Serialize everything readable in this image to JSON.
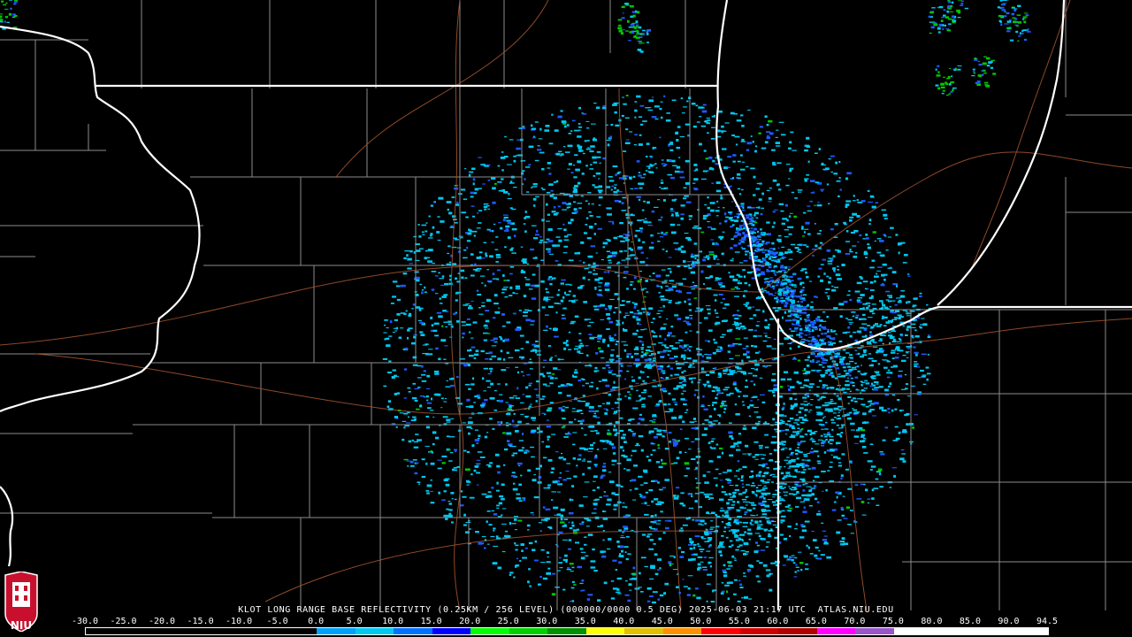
{
  "map": {
    "title": "KLOT LONG RANGE BASE REFLECTIVITY (0.25KM / 256 LEVEL) (000000/0000 0.5 DEG) 2025-06-03 21:17 UTC  ATLAS.NIU.EDU",
    "radar_site": "KLOT",
    "product": "LONG RANGE BASE REFLECTIVITY",
    "elevation": "0.5 DEG",
    "timestamp": "2025-06-03 21:17 UTC",
    "source": "ATLAS.NIU.EDU",
    "colors": {
      "background": "#000000",
      "state_border": "#ffffff",
      "county_border": "#8c8c8c",
      "road": "#a0522d",
      "echo_light": "#00c8f0",
      "echo_mid": "#1e5aff",
      "echo_strong": "#00c800"
    }
  },
  "legend": {
    "labels": [
      "-30.0",
      "-25.0",
      "-20.0",
      "-15.0",
      "-10.0",
      "-5.0",
      "0.0",
      "5.0",
      "10.0",
      "15.0",
      "20.0",
      "25.0",
      "30.0",
      "35.0",
      "40.0",
      "45.0",
      "50.0",
      "55.0",
      "60.0",
      "65.0",
      "70.0",
      "75.0",
      "80.0",
      "85.0",
      "90.0",
      "94.5"
    ],
    "colors": [
      "#000000",
      "#000000",
      "#000000",
      "#000000",
      "#000000",
      "#000000",
      "#00a0ff",
      "#00c8f0",
      "#0070ff",
      "#0000ff",
      "#00ff00",
      "#00d000",
      "#009000",
      "#ffff00",
      "#e0c000",
      "#ff9000",
      "#ff0000",
      "#d00000",
      "#b00000",
      "#ff00ff",
      "#9955c9",
      "#ffffff",
      "#ffffff",
      "#ffffff",
      "#ffffff"
    ]
  },
  "logo": {
    "text": "NIU"
  }
}
